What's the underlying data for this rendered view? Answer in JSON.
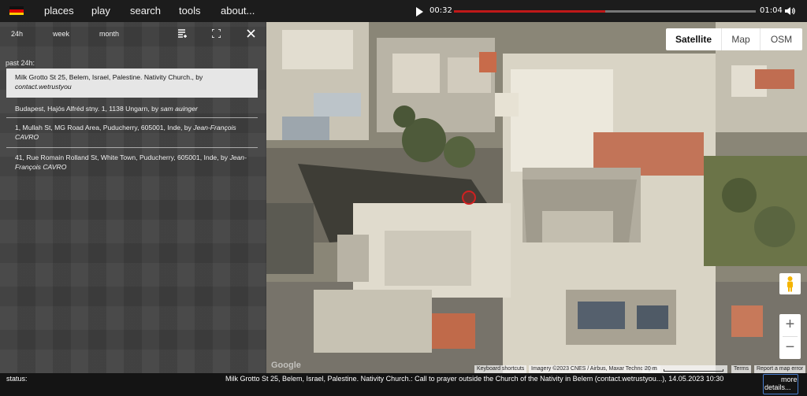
{
  "topbar": {
    "flag": "germany-flag-icon",
    "nav": [
      "places",
      "play",
      "search",
      "tools",
      "about..."
    ],
    "player": {
      "elapsed": "00:32",
      "duration": "01:04",
      "progress": 0.5
    }
  },
  "panel": {
    "tabs": [
      "24h",
      "week",
      "month"
    ],
    "icons": [
      "list-icon",
      "fullscreen-icon",
      "close-icon"
    ],
    "section_title": "past 24h:",
    "items": [
      {
        "address": "Milk Grotto St 25, Belem, Israel, Palestine. Nativity Church., by",
        "author": "contact.wetrustyou",
        "selected": true
      },
      {
        "address": "Budapest, Hajós Alfréd stny. 1, 1138 Ungarn, by",
        "author": "sam auinger",
        "selected": false
      },
      {
        "address": "1, Mullah St, MG Road Area, Puducherry, 605001, Inde, by",
        "author": "Jean-François CAVRO",
        "selected": false
      },
      {
        "address": "41, Rue Romain Rolland St, White Town, Puducherry, 605001, Inde, by",
        "author": "Jean-François CAVRO",
        "selected": false
      }
    ]
  },
  "map": {
    "types": [
      "Satellite",
      "Map",
      "OSM"
    ],
    "active_type": "Satellite",
    "zoom_in": "+",
    "zoom_out": "−",
    "logo": "Google",
    "attribution": {
      "shortcuts": "Keyboard shortcuts",
      "imagery": "Imagery ©2023 CNES / Airbus, Maxar Technologies",
      "scale": "20 m",
      "terms": "Terms",
      "report": "Report a map error"
    }
  },
  "status": {
    "label": "status:",
    "text": "Milk Grotto St 25, Belem, Israel, Palestine. Nativity Church.: Call to prayer outside the Church of the Nativity in Belem (contact.wetrustyou...), 14.05.2023 10:30",
    "more_line1": "more",
    "more_line2": "details..."
  },
  "colors": {
    "topbar": "#1c1c1c",
    "progress": "#c01818",
    "selected_item": "#e6e6e6",
    "link_border": "#4a7fd0"
  }
}
